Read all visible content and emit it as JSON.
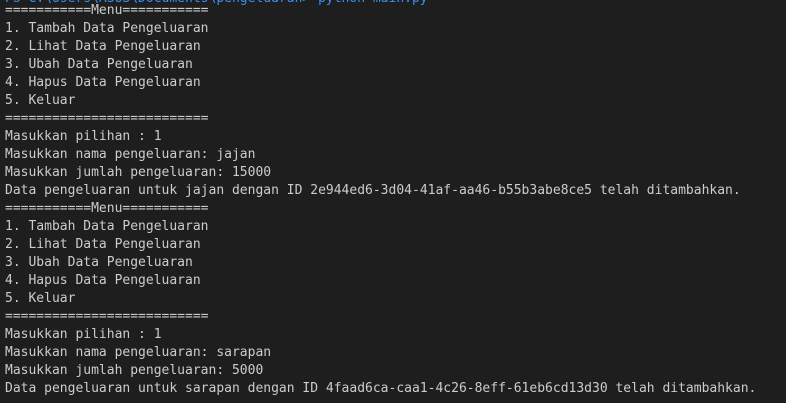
{
  "terminal": {
    "cutoff_line": "PS C:\\Users\\ASUS\\Documents\\pengeluaran> python main.py",
    "lines": [
      "===========Menu===========",
      "1. Tambah Data Pengeluaran",
      "2. Lihat Data Pengeluaran",
      "3. Ubah Data Pengeluaran",
      "4. Hapus Data Pengeluaran",
      "5. Keluar",
      "==========================",
      "Masukkan pilihan : 1",
      "Masukkan nama pengeluaran: jajan",
      "Masukkan jumlah pengeluaran: 15000",
      "Data pengeluaran untuk jajan dengan ID 2e944ed6-3d04-41af-aa46-b55b3abe8ce5 telah ditambahkan.",
      "===========Menu===========",
      "1. Tambah Data Pengeluaran",
      "2. Lihat Data Pengeluaran",
      "3. Ubah Data Pengeluaran",
      "4. Hapus Data Pengeluaran",
      "5. Keluar",
      "==========================",
      "Masukkan pilihan : 1",
      "Masukkan nama pengeluaran: sarapan",
      "Masukkan jumlah pengeluaran: 5000",
      "Data pengeluaran untuk sarapan dengan ID 4faad6ca-caa1-4c26-8eff-61eb6cd13d30 telah ditambahkan."
    ]
  }
}
